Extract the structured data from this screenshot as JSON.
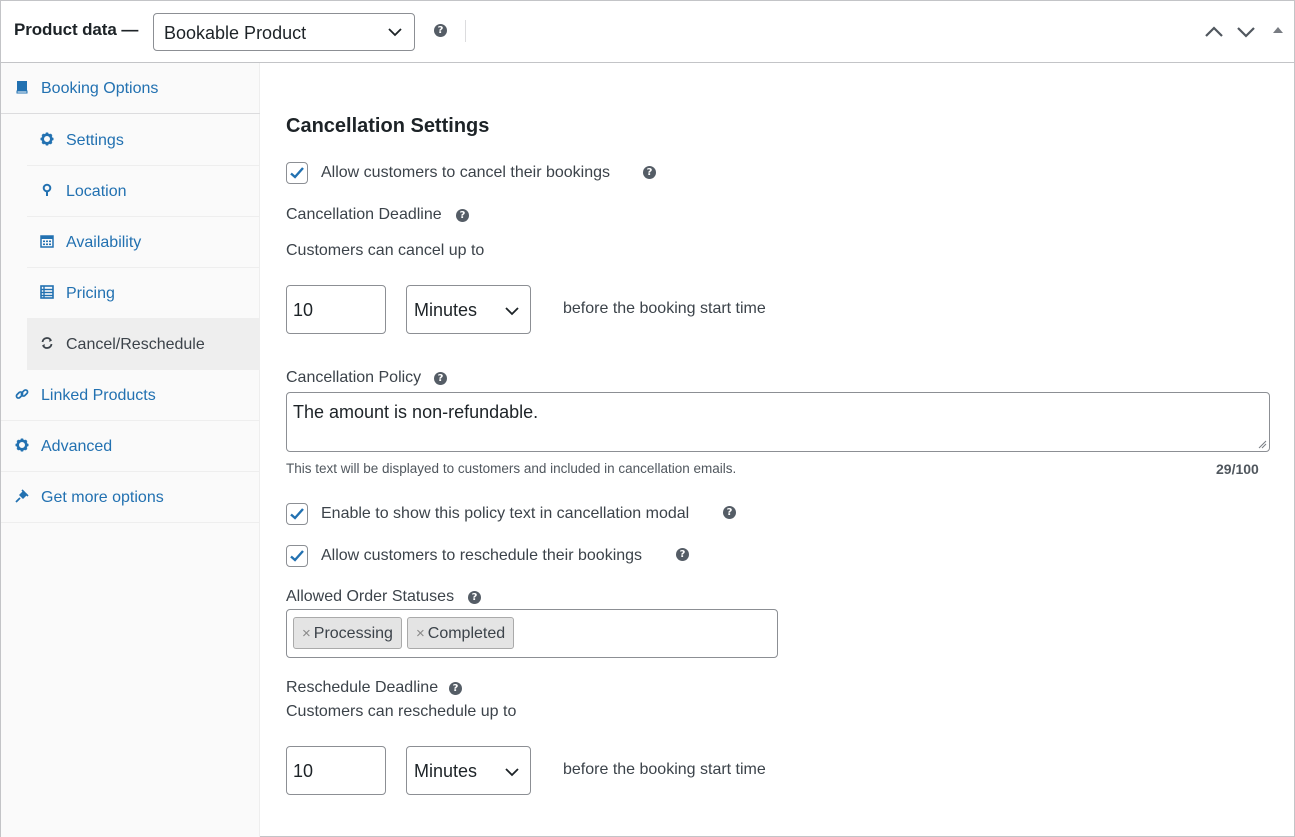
{
  "header": {
    "title": "Product data —",
    "product_type": "Bookable Product",
    "help_icon": "question-icon"
  },
  "sidebar": {
    "items": [
      {
        "label": "Booking Options",
        "icon": "book-icon"
      },
      {
        "label": "Settings",
        "icon": "gear-icon"
      },
      {
        "label": "Location",
        "icon": "location-pin-icon"
      },
      {
        "label": "Availability",
        "icon": "calendar-icon"
      },
      {
        "label": "Pricing",
        "icon": "list-icon"
      },
      {
        "label": "Cancel/Reschedule",
        "icon": "refresh-icon",
        "active": true
      },
      {
        "label": "Linked Products",
        "icon": "link-icon"
      },
      {
        "label": "Advanced",
        "icon": "gear-icon"
      },
      {
        "label": "Get more options",
        "icon": "plugin-icon"
      }
    ]
  },
  "main": {
    "section_title": "Cancellation Settings",
    "allow_cancel": {
      "label": "Allow customers to cancel their bookings",
      "checked": true
    },
    "cancel_deadline": {
      "label": "Cancellation Deadline",
      "sublabel": "Customers can cancel up to",
      "value": "10",
      "unit": "Minutes",
      "suffix": "before the booking start time"
    },
    "policy": {
      "label": "Cancellation Policy",
      "text": "The amount is non-refundable.",
      "hint": "This text will be displayed to customers and included in cancellation emails.",
      "counter": "29/100"
    },
    "show_policy": {
      "label": "Enable to show this policy text in cancellation modal",
      "checked": true
    },
    "allow_reschedule": {
      "label": "Allow customers to reschedule their bookings",
      "checked": true
    },
    "order_statuses": {
      "label": "Allowed Order Statuses",
      "remove_symbol": "×",
      "tags": [
        "Processing",
        "Completed"
      ]
    },
    "reschedule_deadline": {
      "label": "Reschedule Deadline",
      "sublabel": "Customers can reschedule up to",
      "value": "10",
      "unit": "Minutes",
      "suffix": "before the booking start time"
    }
  },
  "colors": {
    "link": "#2271b1",
    "text": "#1d2327",
    "muted": "#3c434a",
    "border": "#8c8f94",
    "active_bg": "#eeeeee"
  }
}
